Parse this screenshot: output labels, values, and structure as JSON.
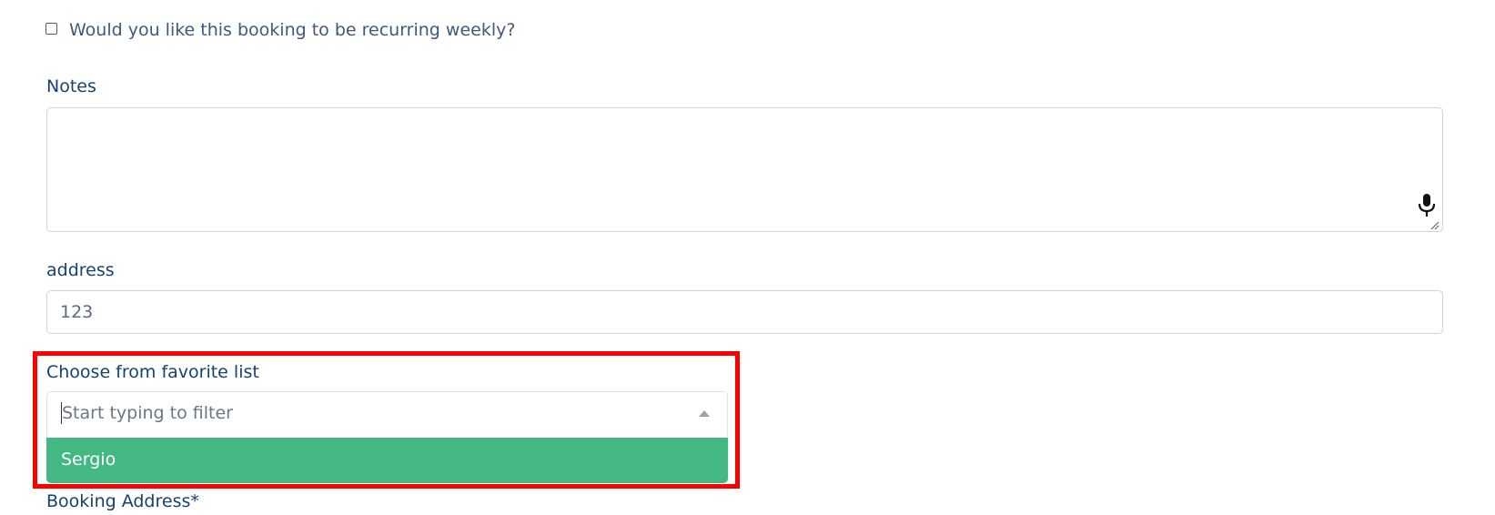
{
  "recurring": {
    "label": "Would you like this booking to be recurring weekly?",
    "checked": false
  },
  "notes": {
    "label": "Notes",
    "value": "",
    "mic_icon": "microphone-icon"
  },
  "address": {
    "label": "address",
    "value": "123"
  },
  "favorites": {
    "label": "Choose from favorite list",
    "placeholder": "Start typing to filter",
    "arrow_icon": "caret-up-icon",
    "options": [
      {
        "label": "Sergio",
        "highlighted": true
      }
    ]
  },
  "booking_address": {
    "label": "Booking Address*"
  },
  "colors": {
    "label_text": "#16426e",
    "highlight_option": "#43b883",
    "annotation_border": "#ff0000"
  }
}
